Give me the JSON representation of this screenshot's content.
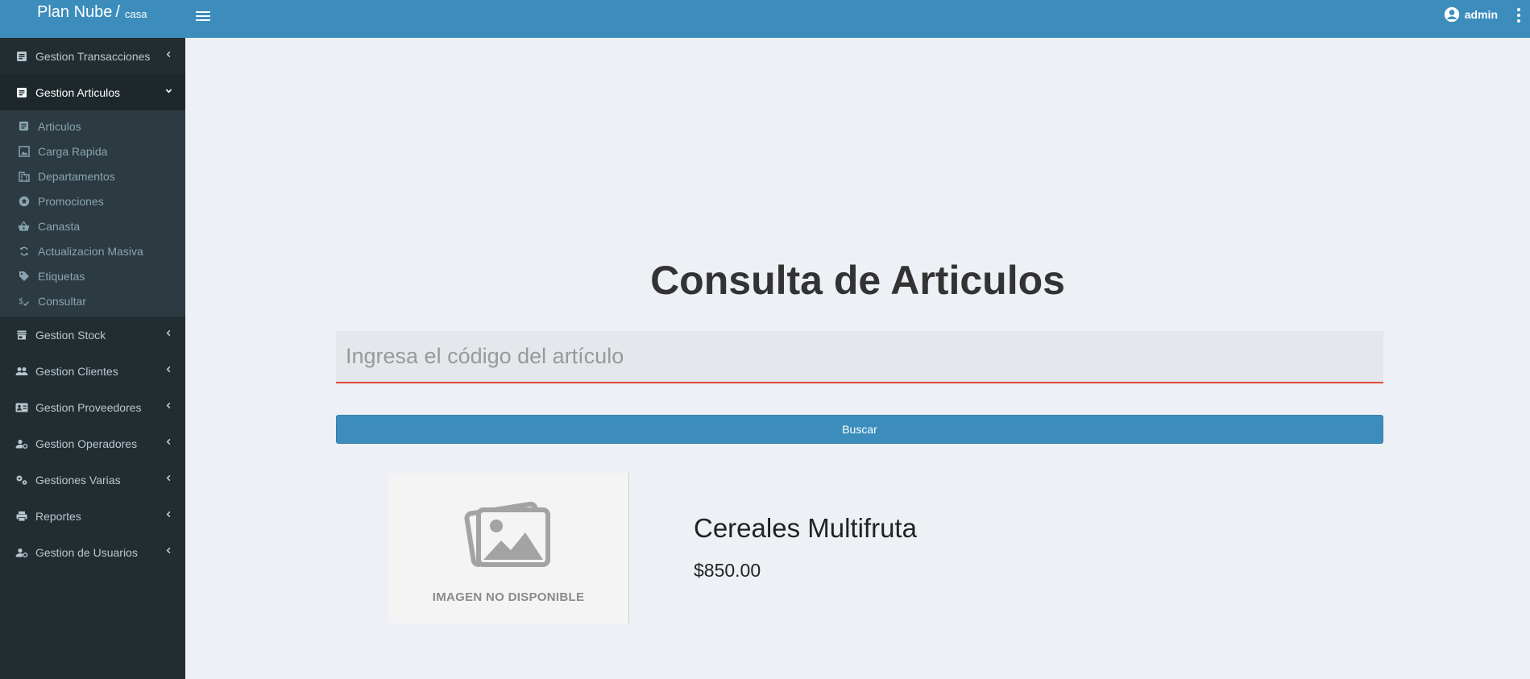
{
  "header": {
    "brand": "Plan Nube",
    "separator": "/",
    "branch": "casa",
    "user": "admin"
  },
  "sidebar": {
    "items": [
      {
        "label": "Gestion Transacciones",
        "icon": "receipt-icon"
      },
      {
        "label": "Gestion Articulos",
        "icon": "receipt-icon",
        "active": true,
        "subitems": [
          {
            "label": "Articulos",
            "icon": "receipt-icon"
          },
          {
            "label": "Carga Rapida",
            "icon": "image-icon"
          },
          {
            "label": "Departamentos",
            "icon": "building-icon"
          },
          {
            "label": "Promociones",
            "icon": "star-badge-icon"
          },
          {
            "label": "Canasta",
            "icon": "basket-icon"
          },
          {
            "label": "Actualizacion Masiva",
            "icon": "refresh-icon"
          },
          {
            "label": "Etiquetas",
            "icon": "tag-icon"
          },
          {
            "label": "Consultar",
            "icon": "price-check-icon"
          }
        ]
      },
      {
        "label": "Gestion Stock",
        "icon": "store-icon"
      },
      {
        "label": "Gestion Clientes",
        "icon": "people-icon"
      },
      {
        "label": "Gestion Proveedores",
        "icon": "contact-card-icon"
      },
      {
        "label": "Gestion Operadores",
        "icon": "person-gear-icon"
      },
      {
        "label": "Gestiones Varias",
        "icon": "gears-icon"
      },
      {
        "label": "Reportes",
        "icon": "printer-icon"
      },
      {
        "label": "Gestion de Usuarios",
        "icon": "person-gear-icon"
      }
    ]
  },
  "main": {
    "title": "Consulta de Articulos",
    "search_placeholder": "Ingresa el código del artículo",
    "search_value": "",
    "search_button": "Buscar",
    "image_caption": "IMAGEN NO DISPONIBLE",
    "product_name": "Cereales Multifruta",
    "product_price": "$850.00"
  },
  "colors": {
    "header": "#3c8dbc",
    "sidebar": "#222d32",
    "submenu": "#2c3b41",
    "background": "#edf0f5",
    "accent_underline": "#dd4b39"
  }
}
